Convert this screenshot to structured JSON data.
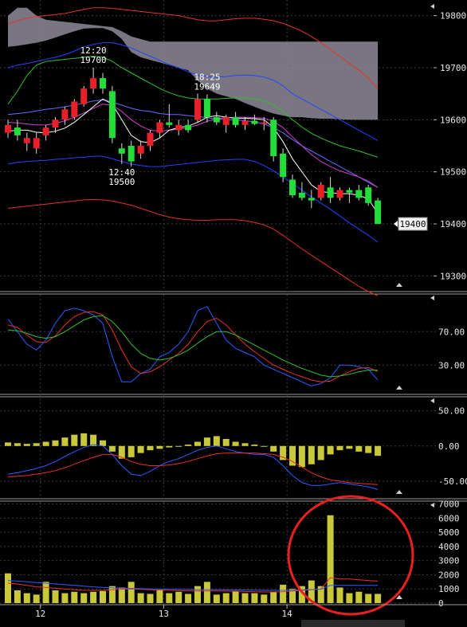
{
  "colors": {
    "background": "#000000",
    "grid": "#3c3c3c",
    "bullish_candle": "#e8202a",
    "bearish_candle": "#22dd3a",
    "volume_bar": "#c8c83a",
    "cloud_fill": "#8e8a98",
    "bollinger_outer": "#e8302a",
    "bollinger_mid": "#2244ff",
    "ma_fast": "#ffffff",
    "ma_mid": "#d040d0",
    "ma_slow": "#30c030",
    "annotation_circle": "#e82020"
  },
  "chart_data": [
    {
      "type": "candlestick",
      "panel": "price",
      "y_ticks": [
        "19800",
        "19700",
        "19600",
        "19500",
        "19400",
        "19300"
      ],
      "y_range": [
        19270,
        19830
      ],
      "x_labels": [
        "12",
        "13",
        "14"
      ],
      "x_label_at_candle": [
        3,
        16,
        29
      ],
      "current_price": "19400",
      "annotations": [
        {
          "time": "12:20",
          "price": "19700",
          "candle": 9,
          "side": "above"
        },
        {
          "time": "18:25",
          "price": "19649",
          "candle": 21,
          "side": "above"
        },
        {
          "time": "12:40",
          "price": "19500",
          "candle": 12,
          "side": "below"
        }
      ],
      "candles": [
        {
          "o": 19575,
          "h": 19600,
          "l": 19565,
          "c": 19590
        },
        {
          "o": 19585,
          "h": 19600,
          "l": 19560,
          "c": 19570
        },
        {
          "o": 19555,
          "h": 19575,
          "l": 19540,
          "c": 19565
        },
        {
          "o": 19545,
          "h": 19575,
          "l": 19535,
          "c": 19565
        },
        {
          "o": 19570,
          "h": 19590,
          "l": 19560,
          "c": 19585
        },
        {
          "o": 19585,
          "h": 19605,
          "l": 19575,
          "c": 19600
        },
        {
          "o": 19600,
          "h": 19625,
          "l": 19590,
          "c": 19620
        },
        {
          "o": 19605,
          "h": 19640,
          "l": 19600,
          "c": 19635
        },
        {
          "o": 19630,
          "h": 19665,
          "l": 19625,
          "c": 19660
        },
        {
          "o": 19660,
          "h": 19700,
          "l": 19650,
          "c": 19680
        },
        {
          "o": 19680,
          "h": 19690,
          "l": 19650,
          "c": 19660
        },
        {
          "o": 19655,
          "h": 19665,
          "l": 19555,
          "c": 19565
        },
        {
          "o": 19545,
          "h": 19555,
          "l": 19515,
          "c": 19535
        },
        {
          "o": 19550,
          "h": 19560,
          "l": 19510,
          "c": 19520
        },
        {
          "o": 19535,
          "h": 19560,
          "l": 19525,
          "c": 19550
        },
        {
          "o": 19550,
          "h": 19580,
          "l": 19540,
          "c": 19575
        },
        {
          "o": 19575,
          "h": 19600,
          "l": 19565,
          "c": 19595
        },
        {
          "o": 19595,
          "h": 19630,
          "l": 19585,
          "c": 19590
        },
        {
          "o": 19580,
          "h": 19600,
          "l": 19570,
          "c": 19590
        },
        {
          "o": 19590,
          "h": 19600,
          "l": 19575,
          "c": 19580
        },
        {
          "o": 19600,
          "h": 19650,
          "l": 19595,
          "c": 19640
        },
        {
          "o": 19640,
          "h": 19649,
          "l": 19595,
          "c": 19605
        },
        {
          "o": 19605,
          "h": 19615,
          "l": 19590,
          "c": 19595
        },
        {
          "o": 19590,
          "h": 19610,
          "l": 19575,
          "c": 19605
        },
        {
          "o": 19605,
          "h": 19615,
          "l": 19585,
          "c": 19590
        },
        {
          "o": 19590,
          "h": 19605,
          "l": 19580,
          "c": 19598
        },
        {
          "o": 19598,
          "h": 19610,
          "l": 19590,
          "c": 19592
        },
        {
          "o": 19592,
          "h": 19605,
          "l": 19580,
          "c": 19595
        },
        {
          "o": 19600,
          "h": 19605,
          "l": 19520,
          "c": 19530
        },
        {
          "o": 19535,
          "h": 19545,
          "l": 19480,
          "c": 19490
        },
        {
          "o": 19485,
          "h": 19495,
          "l": 19450,
          "c": 19455
        },
        {
          "o": 19460,
          "h": 19480,
          "l": 19445,
          "c": 19450
        },
        {
          "o": 19450,
          "h": 19465,
          "l": 19430,
          "c": 19445
        },
        {
          "o": 19450,
          "h": 19480,
          "l": 19445,
          "c": 19475
        },
        {
          "o": 19470,
          "h": 19490,
          "l": 19440,
          "c": 19450
        },
        {
          "o": 19450,
          "h": 19470,
          "l": 19445,
          "c": 19465
        },
        {
          "o": 19465,
          "h": 19470,
          "l": 19440,
          "c": 19460
        },
        {
          "o": 19465,
          "h": 19475,
          "l": 19445,
          "c": 19450
        },
        {
          "o": 19470,
          "h": 19475,
          "l": 19435,
          "c": 19440
        },
        {
          "o": 19445,
          "h": 19450,
          "l": 19400,
          "c": 19400
        }
      ],
      "bollinger_upper2": [
        19784,
        19790,
        19795,
        19798,
        19800,
        19802,
        19804,
        19808,
        19812,
        19815,
        19815,
        19814,
        19812,
        19810,
        19808,
        19806,
        19804,
        19802,
        19800,
        19796,
        19792,
        19790,
        19790,
        19792,
        19794,
        19795,
        19795,
        19793,
        19790,
        19785,
        19778,
        19770,
        19760,
        19748,
        19735,
        19722,
        19708,
        19695,
        19680,
        19660
      ],
      "bollinger_upper1": [
        19700,
        19705,
        19708,
        19712,
        19716,
        19720,
        19725,
        19732,
        19740,
        19745,
        19748,
        19748,
        19744,
        19738,
        19730,
        19722,
        19714,
        19706,
        19700,
        19692,
        19686,
        19683,
        19682,
        19683,
        19685,
        19686,
        19685,
        19682,
        19676,
        19665,
        19650,
        19640,
        19630,
        19620,
        19610,
        19600,
        19590,
        19580,
        19570,
        19560
      ],
      "bollinger_lower1": [
        19515,
        19518,
        19520,
        19521,
        19522,
        19524,
        19525,
        19527,
        19528,
        19530,
        19530,
        19525,
        19520,
        19515,
        19512,
        19510,
        19510,
        19512,
        19514,
        19516,
        19518,
        19520,
        19522,
        19523,
        19524,
        19524,
        19520,
        19512,
        19502,
        19490,
        19478,
        19465,
        19452,
        19440,
        19428,
        19415,
        19402,
        19390,
        19378,
        19365
      ],
      "bollinger_lower2": [
        19430,
        19432,
        19434,
        19436,
        19438,
        19440,
        19442,
        19444,
        19446,
        19447,
        19446,
        19444,
        19440,
        19436,
        19430,
        19424,
        19418,
        19413,
        19410,
        19408,
        19407,
        19407,
        19408,
        19408,
        19408,
        19406,
        19403,
        19398,
        19390,
        19378,
        19365,
        19352,
        19340,
        19328,
        19316,
        19304,
        19292,
        19280,
        19270,
        19262
      ],
      "bollinger_mid": [
        19610,
        19612,
        19614,
        19617,
        19620,
        19622,
        19625,
        19628,
        19632,
        19636,
        19638,
        19634,
        19628,
        19622,
        19618,
        19616,
        19612,
        19610,
        19610,
        19608,
        19606,
        19604,
        19602,
        19600,
        19600,
        19598,
        19596,
        19592,
        19585,
        19575,
        19562,
        19550,
        19540,
        19530,
        19520,
        19510,
        19500,
        19490,
        19480,
        19470
      ],
      "ma_fast": [
        19578,
        19580,
        19580,
        19576,
        19575,
        19578,
        19584,
        19595,
        19610,
        19625,
        19640,
        19630,
        19600,
        19570,
        19558,
        19556,
        19565,
        19580,
        19585,
        19588,
        19595,
        19605,
        19608,
        19605,
        19603,
        19603,
        19602,
        19600,
        19585,
        19558,
        19525,
        19500,
        19475,
        19462,
        19460,
        19458,
        19458,
        19455,
        19448,
        19420
      ],
      "ma_mid": [
        19595,
        19594,
        19592,
        19590,
        19590,
        19593,
        19598,
        19605,
        19613,
        19622,
        19630,
        19628,
        19616,
        19600,
        19588,
        19580,
        19578,
        19580,
        19582,
        19585,
        19590,
        19597,
        19602,
        19604,
        19605,
        19605,
        19604,
        19603,
        19597,
        19585,
        19567,
        19550,
        19533,
        19520,
        19510,
        19502,
        19496,
        19490,
        19482,
        19470
      ],
      "ma_slow": [
        19630,
        19655,
        19685,
        19705,
        19712,
        19714,
        19716,
        19718,
        19720,
        19722,
        19720,
        19712,
        19700,
        19690,
        19680,
        19670,
        19660,
        19652,
        19646,
        19642,
        19640,
        19640,
        19640,
        19641,
        19642,
        19642,
        19640,
        19636,
        19628,
        19616,
        19600,
        19586,
        19574,
        19565,
        19557,
        19550,
        19545,
        19540,
        19534,
        19528
      ],
      "cloud_top": [
        19800,
        19815,
        19815,
        19800,
        19792,
        19790,
        19788,
        19786,
        19784,
        19782,
        19780,
        19778,
        19770,
        19760,
        19755,
        19750,
        19750,
        19750,
        19750,
        19750,
        19750,
        19750,
        19750,
        19750,
        19750,
        19750,
        19750,
        19750,
        19750,
        19750,
        19750,
        19750,
        19750,
        19750,
        19750,
        19750,
        19750,
        19750,
        19750,
        19750
      ],
      "cloud_bottom": [
        19740,
        19742,
        19745,
        19748,
        19752,
        19758,
        19764,
        19770,
        19775,
        19776,
        19776,
        19770,
        19755,
        19730,
        19720,
        19715,
        19710,
        19705,
        19700,
        19695,
        19675,
        19660,
        19650,
        19645,
        19640,
        19632,
        19625,
        19618,
        19612,
        19608,
        19605,
        19605,
        19603,
        19602,
        19602,
        19601,
        19600,
        19600,
        19600,
        19600
      ]
    },
    {
      "type": "line",
      "panel": "oscillator",
      "y_ticks": [
        "70.00",
        "30.00"
      ],
      "y_range": [
        -5,
        115
      ],
      "series": [
        {
          "values": [
            85,
            70,
            55,
            48,
            60,
            80,
            95,
            98,
            95,
            90,
            80,
            40,
            10,
            10,
            20,
            25,
            40,
            45,
            55,
            70,
            95,
            100,
            80,
            60,
            50,
            45,
            40,
            30,
            25,
            20,
            15,
            10,
            5,
            8,
            15,
            30,
            30,
            28,
            25,
            12
          ]
        },
        {
          "values": [
            78,
            75,
            66,
            58,
            57,
            65,
            78,
            88,
            93,
            94,
            90,
            72,
            48,
            28,
            20,
            22,
            28,
            36,
            44,
            55,
            70,
            82,
            86,
            78,
            66,
            55,
            46,
            38,
            30,
            25,
            20,
            16,
            12,
            10,
            11,
            17,
            22,
            26,
            27,
            22
          ]
        },
        {
          "values": [
            72,
            71,
            68,
            64,
            62,
            64,
            70,
            77,
            84,
            88,
            89,
            82,
            70,
            55,
            44,
            38,
            36,
            38,
            42,
            48,
            56,
            64,
            70,
            70,
            66,
            60,
            54,
            48,
            42,
            36,
            31,
            26,
            22,
            18,
            16,
            17,
            19,
            22,
            24,
            24
          ]
        }
      ]
    },
    {
      "type": "bar",
      "panel": "macd",
      "y_ticks": [
        "50.00",
        "0.00",
        "-50.00"
      ],
      "y_range": [
        -75,
        70
      ],
      "histogram": [
        5,
        4,
        3,
        4,
        6,
        8,
        12,
        16,
        18,
        16,
        8,
        -8,
        -18,
        -16,
        -10,
        -6,
        -4,
        -2,
        0,
        2,
        6,
        12,
        14,
        10,
        6,
        4,
        2,
        0,
        -8,
        -20,
        -28,
        -30,
        -26,
        -20,
        -12,
        -6,
        -4,
        -8,
        -10,
        -14
      ],
      "series": [
        {
          "values": [
            -40,
            -38,
            -35,
            -32,
            -28,
            -22,
            -15,
            -8,
            -2,
            2,
            0,
            -12,
            -28,
            -40,
            -42,
            -36,
            -28,
            -22,
            -18,
            -12,
            -6,
            -2,
            0,
            -4,
            -8,
            -10,
            -12,
            -12,
            -16,
            -28,
            -42,
            -52,
            -56,
            -56,
            -54,
            -52,
            -54,
            -56,
            -58,
            -62
          ]
        },
        {
          "values": [
            -44,
            -43,
            -42,
            -40,
            -38,
            -35,
            -31,
            -26,
            -21,
            -16,
            -12,
            -12,
            -16,
            -22,
            -26,
            -28,
            -28,
            -27,
            -25,
            -22,
            -18,
            -14,
            -11,
            -10,
            -10,
            -10,
            -10,
            -11,
            -12,
            -16,
            -22,
            -30,
            -38,
            -44,
            -48,
            -50,
            -52,
            -53,
            -54,
            -55
          ]
        }
      ]
    },
    {
      "type": "bar",
      "panel": "volume",
      "y_ticks": [
        "7000",
        "6000",
        "5000",
        "4000",
        "3000",
        "2000",
        "1000",
        "0"
      ],
      "y_range": [
        0,
        7200
      ],
      "values": [
        2100,
        900,
        700,
        600,
        1500,
        900,
        700,
        800,
        700,
        800,
        850,
        1200,
        1100,
        1500,
        700,
        650,
        900,
        700,
        800,
        650,
        1200,
        1500,
        600,
        700,
        850,
        700,
        700,
        600,
        800,
        1300,
        1000,
        1200,
        1600,
        1200,
        6200,
        1100,
        700,
        800,
        650,
        650
      ],
      "series": [
        {
          "values": [
            1400,
            1350,
            1250,
            1150,
            1100,
            1050,
            1000,
            950,
            900,
            900,
            900,
            950,
            980,
            1000,
            980,
            950,
            930,
            900,
            880,
            860,
            850,
            860,
            860,
            850,
            840,
            820,
            800,
            790,
            790,
            800,
            850,
            900,
            950,
            1000,
            1800,
            1700,
            1700,
            1650,
            1600,
            1550
          ]
        },
        {
          "values": [
            1600,
            1550,
            1500,
            1450,
            1400,
            1350,
            1300,
            1250,
            1200,
            1150,
            1100,
            1080,
            1060,
            1040,
            1020,
            1000,
            990,
            980,
            970,
            960,
            950,
            950,
            950,
            940,
            930,
            920,
            910,
            900,
            900,
            900,
            920,
            940,
            960,
            980,
            1250,
            1250,
            1250,
            1250,
            1250,
            1250
          ]
        }
      ]
    }
  ]
}
